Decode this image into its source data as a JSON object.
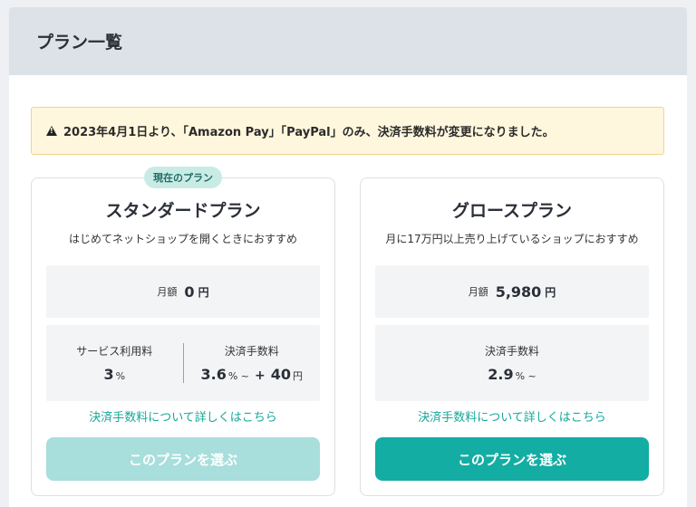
{
  "header": {
    "title": "プラン一覧"
  },
  "notice": {
    "text": "2023年4月1日より、「Amazon Pay」「PayPal」のみ、決済手数料が変更になりました。"
  },
  "colors": {
    "accent": "#13ada3",
    "accent_disabled": "#a8dedb",
    "notice_bg": "#fff7dd"
  },
  "standard": {
    "badge": "現在のプラン",
    "name": "スタンダードプラン",
    "description": "はじめてネットショップを開くときにおすすめ",
    "price_label": "月額",
    "price_value": "0",
    "price_unit": "円",
    "service_fee_title": "サービス利用料",
    "service_fee_value": "3",
    "service_fee_unit": "%",
    "payment_fee_title": "決済手数料",
    "payment_fee_value": "3.6",
    "payment_fee_unit": "% ~",
    "payment_fee_plus": "+",
    "payment_fee_fixed": "40",
    "payment_fee_fixed_unit": "円",
    "link": "決済手数料について詳しくはこちら",
    "button": "このプランを選ぶ"
  },
  "growth": {
    "name": "グロースプラン",
    "description": "月に17万円以上売り上げているショップにおすすめ",
    "price_label": "月額",
    "price_value": "5,980",
    "price_unit": "円",
    "payment_fee_title": "決済手数料",
    "payment_fee_value": "2.9",
    "payment_fee_unit": "% ~",
    "link": "決済手数料について詳しくはこちら",
    "button": "このプランを選ぶ"
  }
}
